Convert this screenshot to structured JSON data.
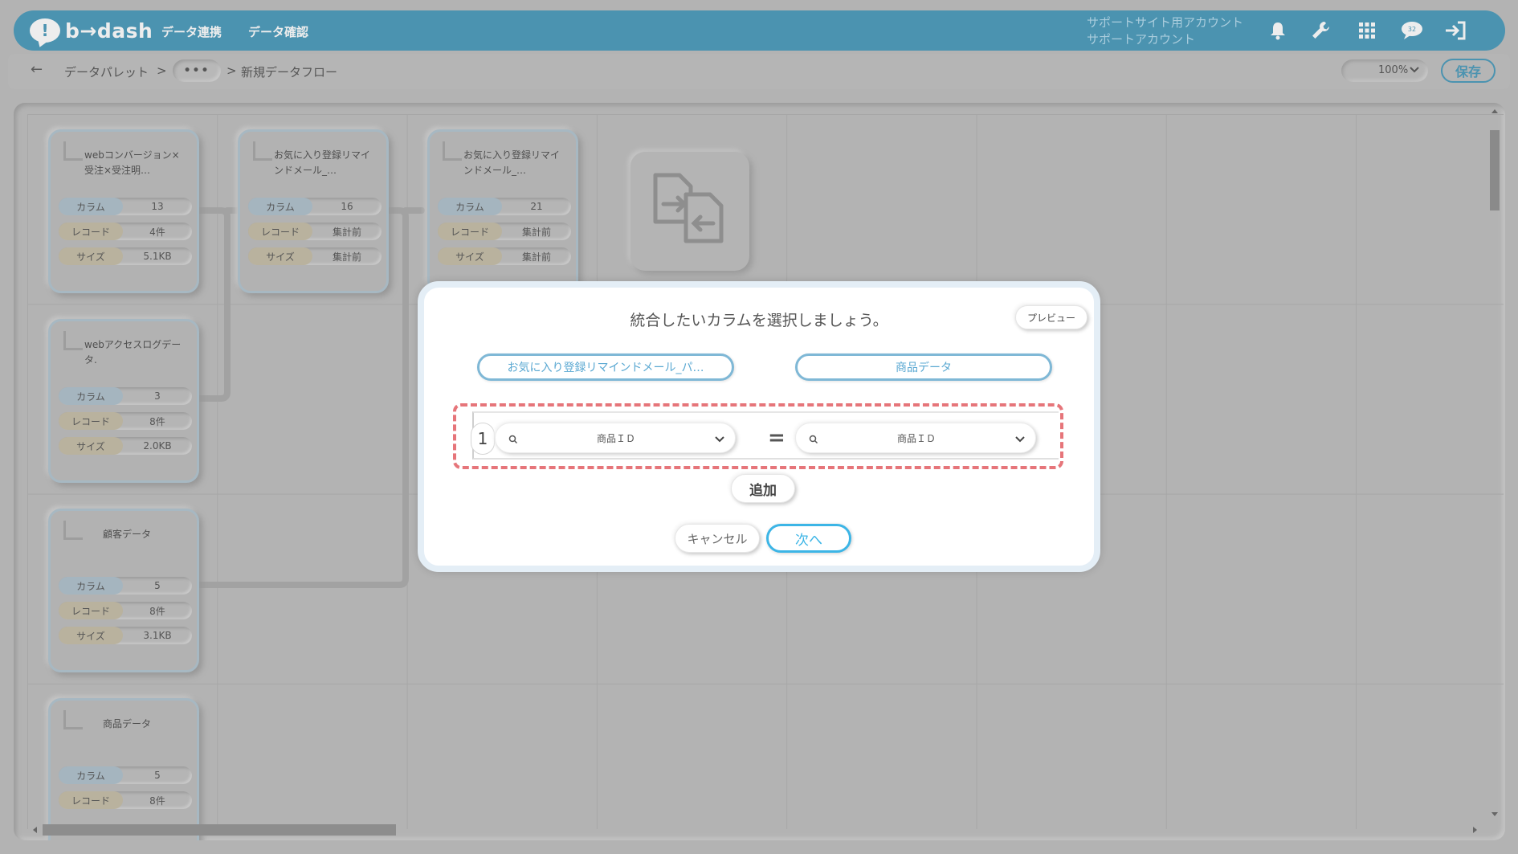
{
  "header": {
    "logo_mark": "!",
    "logo_text": "b→dash",
    "nav": [
      "データ連携",
      "データ確認"
    ],
    "account_line1": "サポートサイト用アカウント",
    "account_line2": "サポートアカウント",
    "icons": [
      "bell-icon",
      "wrench-icon",
      "grid-icon",
      "chat-icon",
      "logout-icon"
    ],
    "chat_badge": "32",
    "colors": {
      "bar": "#4b93b0",
      "text": "#ededed"
    }
  },
  "breadcrumb": {
    "back": "←",
    "root": "データパレット",
    "sep1": ">",
    "more": "•••",
    "sep2": ">",
    "current": "新規データフロー",
    "zoom": "100%",
    "save": "保存"
  },
  "nodes": [
    {
      "title": "webコンバージョン×受注×受注明…",
      "column_label": "カラム",
      "column": "13",
      "record_label": "レコード",
      "record": "4件",
      "size_label": "サイズ",
      "size": "5.1KB"
    },
    {
      "title": "お気に入り登録リマインドメール_…",
      "column_label": "カラム",
      "column": "16",
      "record_label": "レコード",
      "record": "集計前",
      "size_label": "サイズ",
      "size": "集計前"
    },
    {
      "title": "お気に入り登録リマインドメール_…",
      "column_label": "カラム",
      "column": "21",
      "record_label": "レコード",
      "record": "集計前",
      "size_label": "サイズ",
      "size": "集計前"
    },
    {
      "title": "webアクセスログデータ.",
      "column_label": "カラム",
      "column": "3",
      "record_label": "レコード",
      "record": "8件",
      "size_label": "サイズ",
      "size": "2.0KB"
    },
    {
      "title": "顧客データ",
      "column_label": "カラム",
      "column": "5",
      "record_label": "レコード",
      "record": "8件",
      "size_label": "サイズ",
      "size": "3.1KB"
    },
    {
      "title": "商品データ",
      "column_label": "カラム",
      "column": "5",
      "record_label": "レコード",
      "record": "8件"
    }
  ],
  "modal": {
    "title": "統合したいカラムを選択しましょう。",
    "preview": "プレビュー",
    "left_table": "お気に入り登録リマインドメール_パ…",
    "right_table": "商品データ",
    "row_number": "1",
    "left_column": "商品ＩＤ",
    "equals": "=",
    "right_column": "商品ＩＤ",
    "add": "追加",
    "cancel": "キャンセル",
    "next": "次へ",
    "colors": {
      "accent": "#3cb5e6",
      "highlight_dash": "#e6757a"
    }
  }
}
